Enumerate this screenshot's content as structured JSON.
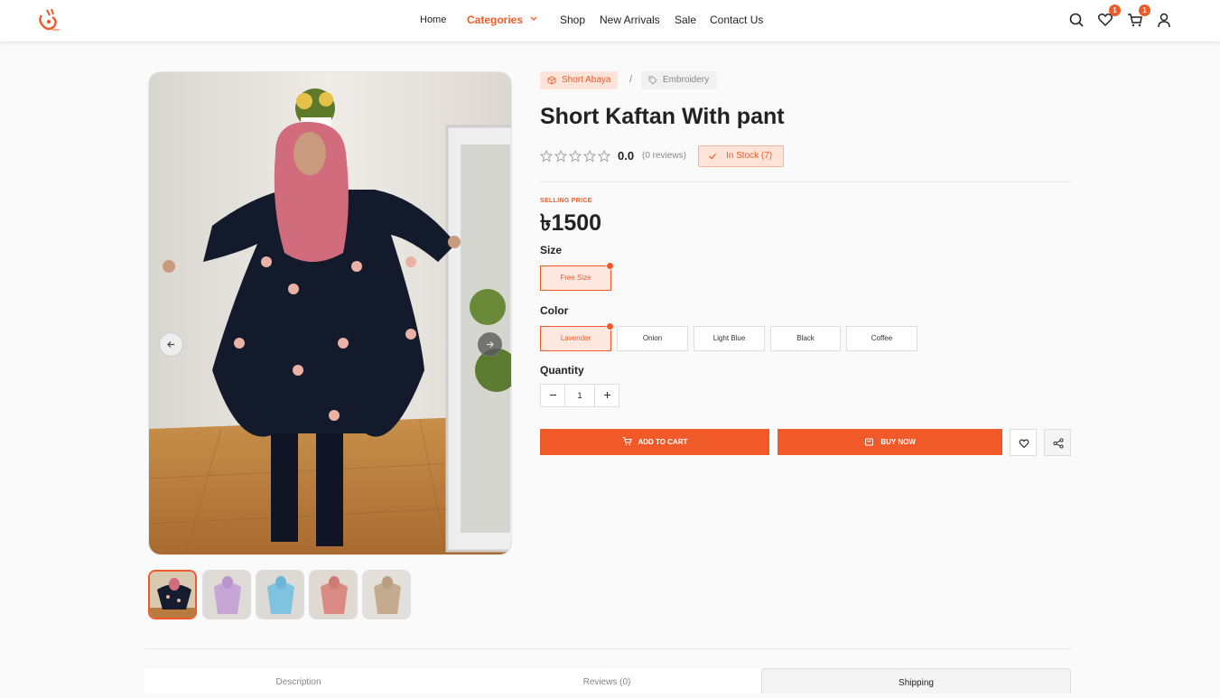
{
  "nav": {
    "items": [
      {
        "label": "Home"
      },
      {
        "label": "Categories"
      },
      {
        "label": "Shop"
      },
      {
        "label": "New Arrivals"
      },
      {
        "label": "Sale"
      },
      {
        "label": "Contact Us"
      }
    ],
    "wishlist_count": "1",
    "cart_count": "1"
  },
  "product": {
    "category_tag": "Short Abaya",
    "tag": "Embroidery",
    "breadcrumb_sep": "/",
    "title": "Short Kaftan With pant",
    "rating": "0.0",
    "reviews": "(0 reviews)",
    "stock": "In Stock (7)",
    "selling_price_label": "SELLING PRICE",
    "price": "৳1500",
    "size_label": "Size",
    "sizes": [
      {
        "label": "Free Size",
        "selected": true
      }
    ],
    "color_label": "Color",
    "colors": [
      {
        "label": "Lavender",
        "selected": true
      },
      {
        "label": "Onion"
      },
      {
        "label": "Light Blue"
      },
      {
        "label": "Black"
      },
      {
        "label": "Coffee"
      }
    ],
    "quantity_label": "Quantity",
    "quantity": "1",
    "add_to_cart": "ADD TO CART",
    "buy_now": "BUY NOW"
  },
  "thumbnails": [
    "black",
    "lavender",
    "light-blue",
    "onion",
    "coffee"
  ],
  "colors": {
    "accent": "#f05a28",
    "accent_light": "#fde3d8"
  },
  "tabs": [
    {
      "label": "Description"
    },
    {
      "label": "Reviews (0)"
    },
    {
      "label": "Shipping",
      "active": true
    }
  ]
}
